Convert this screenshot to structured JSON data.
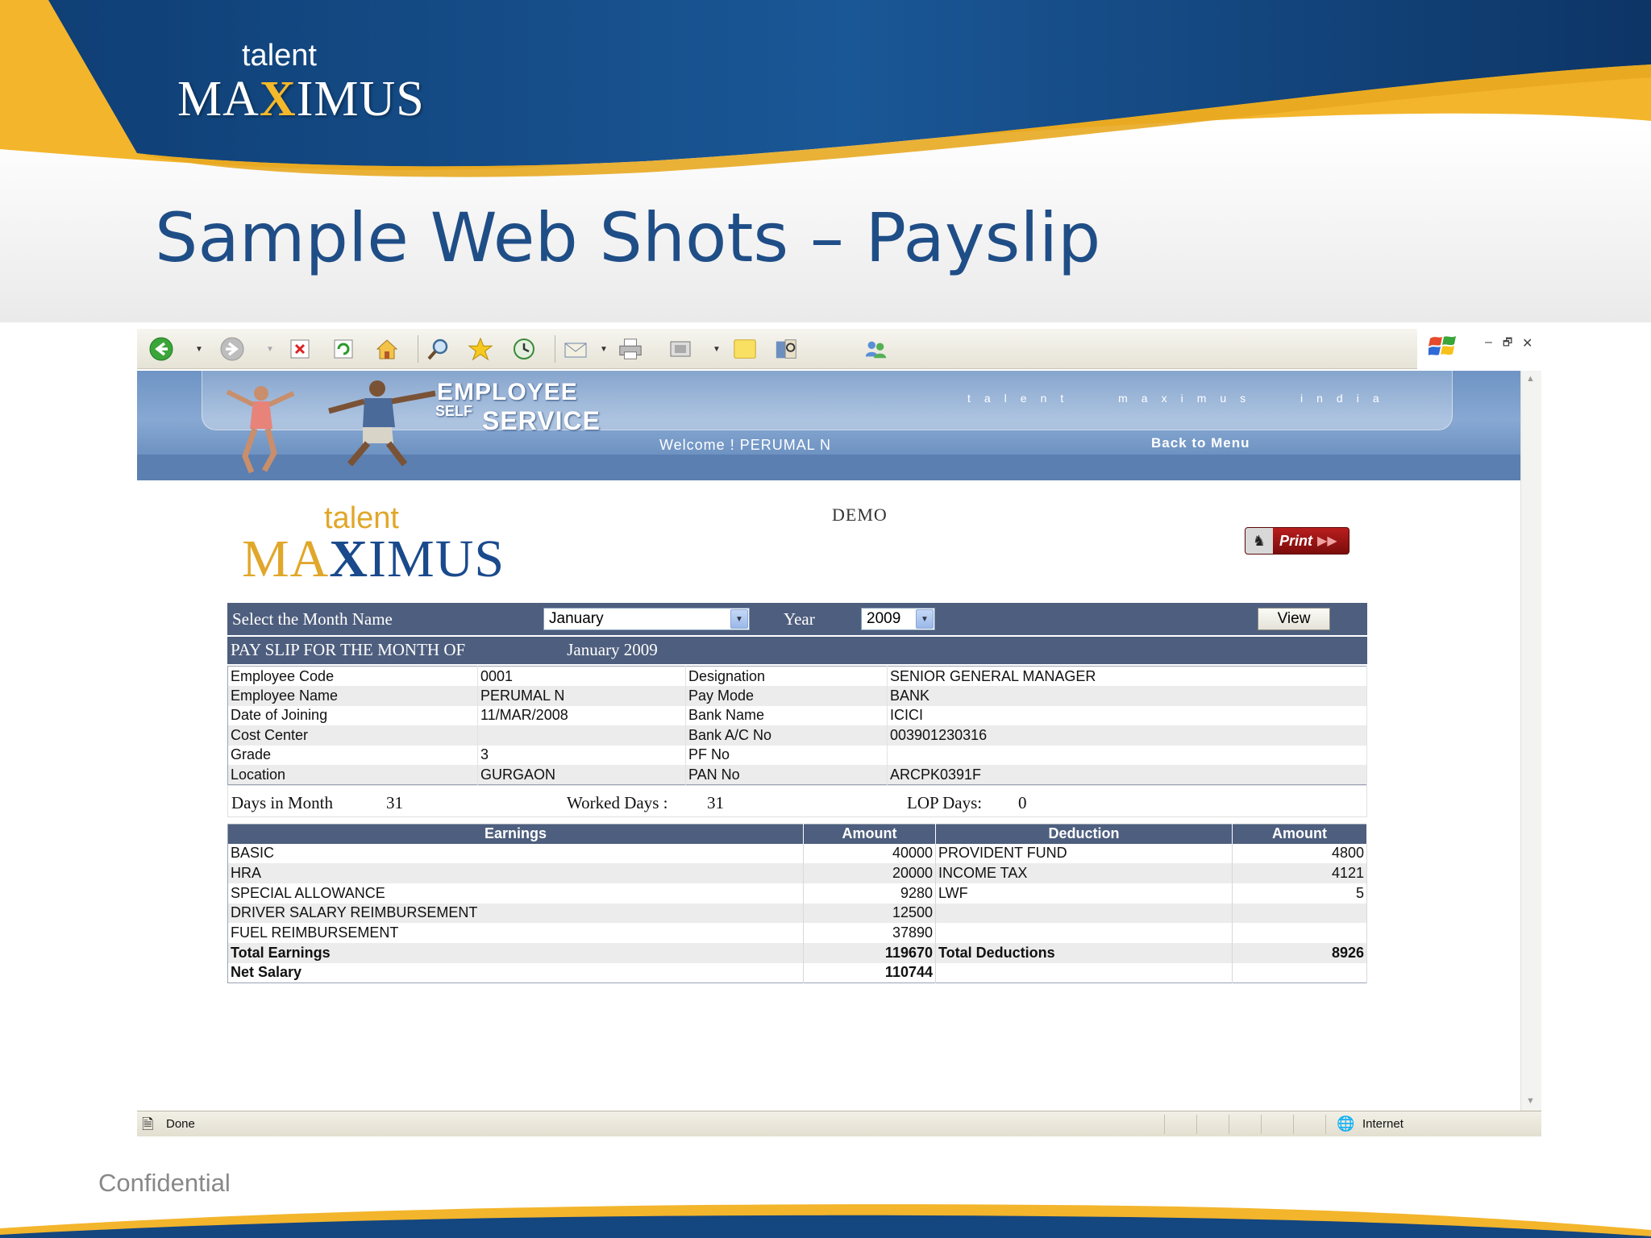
{
  "slide": {
    "brand_talent": "talent",
    "brand_maximus_a": "MA",
    "brand_maximus_x": "X",
    "brand_maximus_b": "IMUS",
    "title": "Sample Web Shots – Payslip",
    "footer": "Confidential",
    "colors": {
      "navy": "#1f4e87",
      "gold": "#f5b82a",
      "table_header": "#4e5e7e"
    }
  },
  "browser": {
    "toolbar_icons": [
      "back-icon",
      "forward-icon",
      "stop-icon",
      "refresh-icon",
      "home-icon",
      "search-icon",
      "favorites-icon",
      "history-icon",
      "mail-icon",
      "print-icon",
      "edit-icon",
      "note-icon",
      "research-icon",
      "messenger-icon"
    ],
    "status_left": "Done",
    "status_right": "Internet"
  },
  "banner": {
    "title_line1": "EMPLOYEE",
    "title_self": "SELF",
    "title_service": "SERVICE",
    "tagline": "talent maximus india",
    "welcome": "Welcome ! PERUMAL N",
    "back_to_menu": "Back to Menu"
  },
  "page": {
    "demo": "DEMO",
    "logo_talent": "talent",
    "logo_ma": "MA",
    "logo_x": "X",
    "logo_imus": "IMUS",
    "print_label": "Print",
    "select_month_label": "Select the Month Name",
    "month_value": "January",
    "year_label": "Year",
    "year_value": "2009",
    "view_label": "View",
    "payslip_heading": "PAY SLIP FOR THE MONTH OF",
    "payslip_period": "January 2009"
  },
  "employee": [
    [
      "Employee Code",
      "0001",
      "Designation",
      "SENIOR GENERAL MANAGER"
    ],
    [
      "Employee Name",
      "PERUMAL N",
      "Pay Mode",
      "BANK"
    ],
    [
      "Date of Joining",
      "11/MAR/2008",
      "Bank Name",
      "ICICI"
    ],
    [
      "Cost Center",
      "",
      "Bank A/C No",
      "003901230316"
    ],
    [
      "Grade",
      "3",
      "PF No",
      ""
    ],
    [
      "Location",
      "GURGAON",
      "PAN No",
      "ARCPK0391F"
    ]
  ],
  "days": {
    "days_in_month_label": "Days in Month",
    "days_in_month": "31",
    "worked_days_label": "Worked Days :",
    "worked_days": "31",
    "lop_days_label": "LOP Days:",
    "lop_days": "0"
  },
  "earnings": {
    "headers": [
      "Earnings",
      "Amount",
      "Deduction",
      "Amount"
    ],
    "rows": [
      [
        "BASIC",
        "40000",
        "PROVIDENT FUND",
        "4800"
      ],
      [
        "HRA",
        "20000",
        "INCOME TAX",
        "4121"
      ],
      [
        "SPECIAL ALLOWANCE",
        "9280",
        "LWF",
        "5"
      ],
      [
        "DRIVER SALARY REIMBURSEMENT",
        "12500",
        "",
        ""
      ],
      [
        "FUEL REIMBURSEMENT",
        "37890",
        "",
        ""
      ]
    ],
    "total_row": [
      "Total Earnings",
      "119670",
      "Total Deductions",
      "8926"
    ],
    "net_row": [
      "Net Salary",
      "110744",
      "",
      ""
    ]
  }
}
